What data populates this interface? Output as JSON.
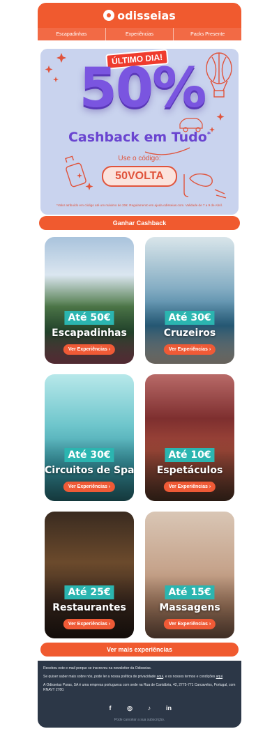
{
  "header": {
    "brand": "odisseias"
  },
  "nav": {
    "items": [
      "Escapadinhas",
      "Experiências",
      "Packs Presente"
    ]
  },
  "hero": {
    "badge": "ÚLTIMO DIA!",
    "big": "50%",
    "subtitle": "Cashback em Tudo",
    "asterisk": "*",
    "code_label": "Use o código:",
    "code": "50VOLTA",
    "note": "*Valor atribuído em código até um máximo de 20€. Regulamento em ajuda.odisseias.com. Validade de 7 a 9 de Abril."
  },
  "cta_primary": "Ganhar Cashback",
  "cards": [
    {
      "price": "Até 50€",
      "title": "Escapadinhas",
      "button": "Ver Experiências ›"
    },
    {
      "price": "Até 30€",
      "title": "Cruzeiros",
      "button": "Ver Experiências ›"
    },
    {
      "price": "Até 30€",
      "title": "Circuitos de Spa",
      "button": "Ver Experiências ›"
    },
    {
      "price": "Até 10€",
      "title": "Espetáculos",
      "button": "Ver Experiências ›"
    },
    {
      "price": "Até 25€",
      "title": "Restaurantes",
      "button": "Ver Experiências ›"
    },
    {
      "price": "Até 15€",
      "title": "Massagens",
      "button": "Ver Experiências ›"
    }
  ],
  "cta_secondary": "Ver mais experiências",
  "footer": {
    "line1": "Recebeu este e-mail porque se inscreveu na newsletter da Odisseias.",
    "line2_a": "Se quiser saber mais sobre nós, pode ler a nossa política de privacidade ",
    "line2_link1": "aqui",
    "line2_b": ", e os nossos termos e condições ",
    "line2_link2": "aqui",
    "line2_c": ".",
    "line3": "A Odisseias Puras, SA é uma empresa portuguesa com sede na Rua de Cantábria, 42, 2775-771 Carcavelos, Portugal, com RNAVT 2780.",
    "socials": [
      "facebook-icon",
      "instagram-icon",
      "tiktok-icon",
      "linkedin-icon"
    ],
    "social_glyphs": [
      "f",
      "◎",
      "♪",
      "in"
    ],
    "unsubscribe": "Pode cancelar a sua subscrição."
  },
  "colors": {
    "brand": "#f05a2f",
    "teal": "#2bb5b0",
    "purple": "#7a55e0",
    "footer": "#2c3747"
  }
}
